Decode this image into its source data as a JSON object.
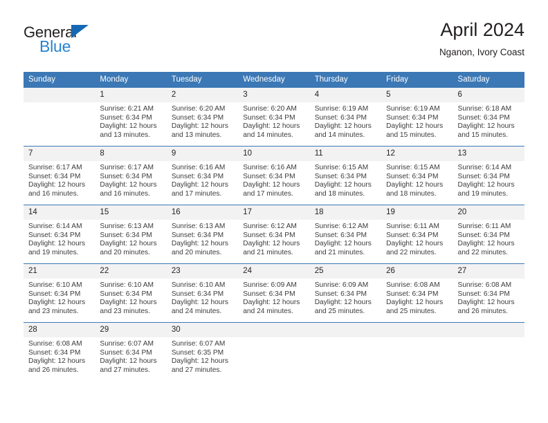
{
  "brand": {
    "name_top": "General",
    "name_bottom": "Blue",
    "accent_color": "#2585d3",
    "triangle_color": "#1668b3"
  },
  "header": {
    "title": "April 2024",
    "subtitle": "Nganon, Ivory Coast"
  },
  "theme": {
    "header_blue": "#3b78b5",
    "daynum_gray": "#f2f2f2",
    "text_color": "#231f20"
  },
  "weekday_headers": [
    "Sunday",
    "Monday",
    "Tuesday",
    "Wednesday",
    "Thursday",
    "Friday",
    "Saturday"
  ],
  "weeks": [
    [
      {
        "day": "",
        "lines": []
      },
      {
        "day": "1",
        "lines": [
          "Sunrise: 6:21 AM",
          "Sunset: 6:34 PM",
          "Daylight: 12 hours and 13 minutes."
        ]
      },
      {
        "day": "2",
        "lines": [
          "Sunrise: 6:20 AM",
          "Sunset: 6:34 PM",
          "Daylight: 12 hours and 13 minutes."
        ]
      },
      {
        "day": "3",
        "lines": [
          "Sunrise: 6:20 AM",
          "Sunset: 6:34 PM",
          "Daylight: 12 hours and 14 minutes."
        ]
      },
      {
        "day": "4",
        "lines": [
          "Sunrise: 6:19 AM",
          "Sunset: 6:34 PM",
          "Daylight: 12 hours and 14 minutes."
        ]
      },
      {
        "day": "5",
        "lines": [
          "Sunrise: 6:19 AM",
          "Sunset: 6:34 PM",
          "Daylight: 12 hours and 15 minutes."
        ]
      },
      {
        "day": "6",
        "lines": [
          "Sunrise: 6:18 AM",
          "Sunset: 6:34 PM",
          "Daylight: 12 hours and 15 minutes."
        ]
      }
    ],
    [
      {
        "day": "7",
        "lines": [
          "Sunrise: 6:17 AM",
          "Sunset: 6:34 PM",
          "Daylight: 12 hours and 16 minutes."
        ]
      },
      {
        "day": "8",
        "lines": [
          "Sunrise: 6:17 AM",
          "Sunset: 6:34 PM",
          "Daylight: 12 hours and 16 minutes."
        ]
      },
      {
        "day": "9",
        "lines": [
          "Sunrise: 6:16 AM",
          "Sunset: 6:34 PM",
          "Daylight: 12 hours and 17 minutes."
        ]
      },
      {
        "day": "10",
        "lines": [
          "Sunrise: 6:16 AM",
          "Sunset: 6:34 PM",
          "Daylight: 12 hours and 17 minutes."
        ]
      },
      {
        "day": "11",
        "lines": [
          "Sunrise: 6:15 AM",
          "Sunset: 6:34 PM",
          "Daylight: 12 hours and 18 minutes."
        ]
      },
      {
        "day": "12",
        "lines": [
          "Sunrise: 6:15 AM",
          "Sunset: 6:34 PM",
          "Daylight: 12 hours and 18 minutes."
        ]
      },
      {
        "day": "13",
        "lines": [
          "Sunrise: 6:14 AM",
          "Sunset: 6:34 PM",
          "Daylight: 12 hours and 19 minutes."
        ]
      }
    ],
    [
      {
        "day": "14",
        "lines": [
          "Sunrise: 6:14 AM",
          "Sunset: 6:34 PM",
          "Daylight: 12 hours and 19 minutes."
        ]
      },
      {
        "day": "15",
        "lines": [
          "Sunrise: 6:13 AM",
          "Sunset: 6:34 PM",
          "Daylight: 12 hours and 20 minutes."
        ]
      },
      {
        "day": "16",
        "lines": [
          "Sunrise: 6:13 AM",
          "Sunset: 6:34 PM",
          "Daylight: 12 hours and 20 minutes."
        ]
      },
      {
        "day": "17",
        "lines": [
          "Sunrise: 6:12 AM",
          "Sunset: 6:34 PM",
          "Daylight: 12 hours and 21 minutes."
        ]
      },
      {
        "day": "18",
        "lines": [
          "Sunrise: 6:12 AM",
          "Sunset: 6:34 PM",
          "Daylight: 12 hours and 21 minutes."
        ]
      },
      {
        "day": "19",
        "lines": [
          "Sunrise: 6:11 AM",
          "Sunset: 6:34 PM",
          "Daylight: 12 hours and 22 minutes."
        ]
      },
      {
        "day": "20",
        "lines": [
          "Sunrise: 6:11 AM",
          "Sunset: 6:34 PM",
          "Daylight: 12 hours and 22 minutes."
        ]
      }
    ],
    [
      {
        "day": "21",
        "lines": [
          "Sunrise: 6:10 AM",
          "Sunset: 6:34 PM",
          "Daylight: 12 hours and 23 minutes."
        ]
      },
      {
        "day": "22",
        "lines": [
          "Sunrise: 6:10 AM",
          "Sunset: 6:34 PM",
          "Daylight: 12 hours and 23 minutes."
        ]
      },
      {
        "day": "23",
        "lines": [
          "Sunrise: 6:10 AM",
          "Sunset: 6:34 PM",
          "Daylight: 12 hours and 24 minutes."
        ]
      },
      {
        "day": "24",
        "lines": [
          "Sunrise: 6:09 AM",
          "Sunset: 6:34 PM",
          "Daylight: 12 hours and 24 minutes."
        ]
      },
      {
        "day": "25",
        "lines": [
          "Sunrise: 6:09 AM",
          "Sunset: 6:34 PM",
          "Daylight: 12 hours and 25 minutes."
        ]
      },
      {
        "day": "26",
        "lines": [
          "Sunrise: 6:08 AM",
          "Sunset: 6:34 PM",
          "Daylight: 12 hours and 25 minutes."
        ]
      },
      {
        "day": "27",
        "lines": [
          "Sunrise: 6:08 AM",
          "Sunset: 6:34 PM",
          "Daylight: 12 hours and 26 minutes."
        ]
      }
    ],
    [
      {
        "day": "28",
        "lines": [
          "Sunrise: 6:08 AM",
          "Sunset: 6:34 PM",
          "Daylight: 12 hours and 26 minutes."
        ]
      },
      {
        "day": "29",
        "lines": [
          "Sunrise: 6:07 AM",
          "Sunset: 6:34 PM",
          "Daylight: 12 hours and 27 minutes."
        ]
      },
      {
        "day": "30",
        "lines": [
          "Sunrise: 6:07 AM",
          "Sunset: 6:35 PM",
          "Daylight: 12 hours and 27 minutes."
        ]
      },
      {
        "day": "",
        "lines": []
      },
      {
        "day": "",
        "lines": []
      },
      {
        "day": "",
        "lines": []
      },
      {
        "day": "",
        "lines": []
      }
    ]
  ]
}
